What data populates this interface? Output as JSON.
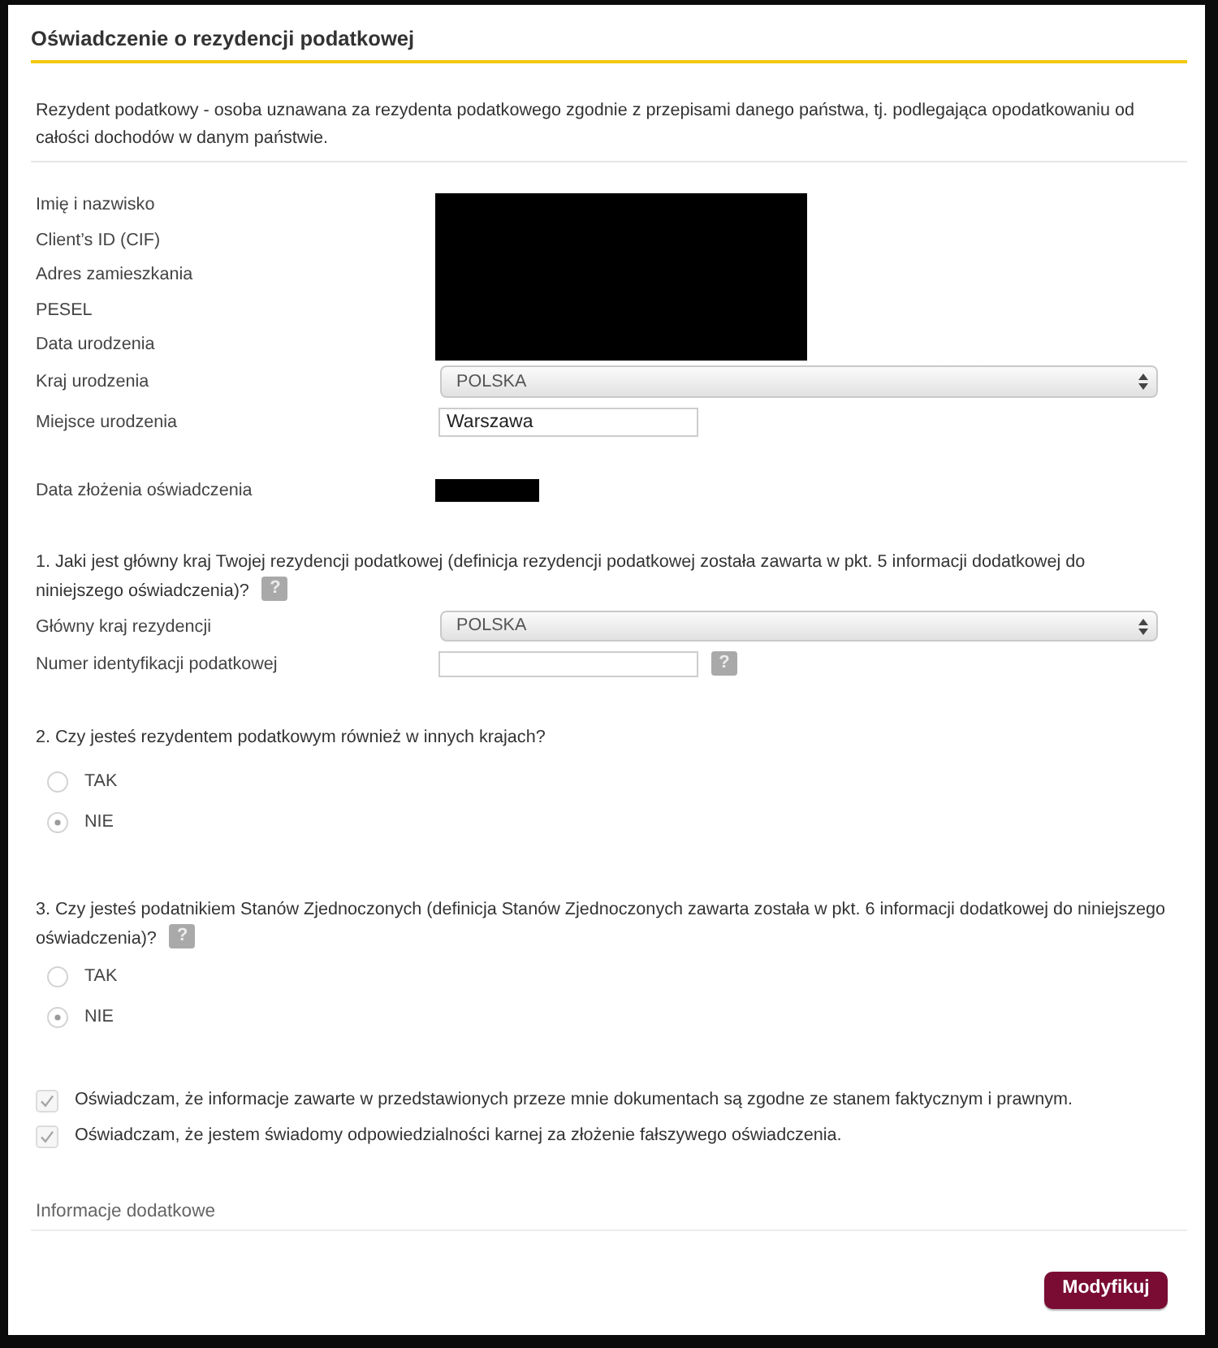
{
  "header": {
    "title": "Oświadczenie o rezydencji podatkowej"
  },
  "intro": "Rezydent podatkowy - osoba uznawana za rezydenta podatkowego zgodnie z przepisami danego państwa, tj. podlegająca opodatkowaniu od całości dochodów w danym państwie.",
  "personal_data": [
    {
      "label": "Imię i nazwisko",
      "kind": "redacted"
    },
    {
      "label": "Client’s ID (CIF)",
      "kind": "redacted"
    },
    {
      "label": "Adres zamieszkania",
      "kind": "redacted"
    },
    {
      "label": "PESEL",
      "kind": "redacted"
    },
    {
      "label": "Data urodzenia",
      "kind": "redacted"
    },
    {
      "label": "Kraj urodzenia",
      "kind": "select",
      "value": "POLSKA"
    },
    {
      "label": "Miejsce urodzenia",
      "kind": "text",
      "value": "Warszawa"
    }
  ],
  "declaration_date": {
    "label": "Data złożenia oświadczenia",
    "kind": "redacted"
  },
  "questions": [
    {
      "text": "1. Jaki jest główny kraj Twojej rezydencji podatkowej (definicja rezydencji podatkowej została zawarta w pkt. 5 informacji dodatkowej do niniejszego oświadczenia)?",
      "help": "?",
      "fields": [
        {
          "label": "Główny kraj rezydencji",
          "kind": "select",
          "value": "POLSKA"
        },
        {
          "label": "Numer identyfikacji podatkowej",
          "kind": "text",
          "help": "?"
        }
      ]
    },
    {
      "text": "2. Czy jesteś rezydentem podatkowym również w innych krajach?",
      "options": [
        {
          "label": "TAK",
          "selected": false
        },
        {
          "label": "NIE",
          "selected": true
        }
      ]
    },
    {
      "text": "3. Czy jesteś podatnikiem Stanów Zjednoczonych (definicja Stanów Zjednoczonych zawarta została w pkt. 6 informacji dodatkowej do niniejszego oświadczenia)?",
      "help": "?",
      "options": [
        {
          "label": "TAK",
          "selected": false
        },
        {
          "label": "NIE",
          "selected": true
        }
      ]
    }
  ],
  "declarations": [
    {
      "text": "Oświadczam, że informacje zawarte w przedstawionych przeze mnie dokumentach są zgodne ze stanem faktycznym i prawnym.",
      "checked": true
    },
    {
      "text": "Oświadczam, że jestem świadomy odpowiedzialności karnej za złożenie fałszywego oświadczenia.",
      "checked": true
    }
  ],
  "additional_info": {
    "title": "Informacje dodatkowe"
  },
  "buttons": [
    {
      "label": "Modyfikuj"
    }
  ]
}
